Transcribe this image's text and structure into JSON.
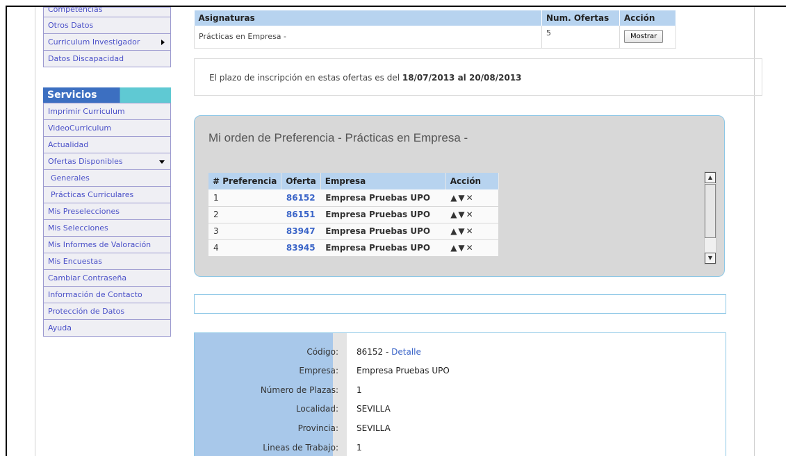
{
  "sidebar": {
    "cut_item": "Competencias",
    "items_top": [
      "Otros Datos",
      "Curriculum Investigador",
      "Datos Discapacidad"
    ],
    "services_title": "Servicios",
    "services_items": [
      "Imprimir Curriculum",
      "VideoCurriculum",
      "Actualidad",
      "Ofertas Disponibles",
      "Generales",
      "Prácticas Curriculares",
      "Mis Preselecciones",
      "Mis Selecciones",
      "Mis Informes de Valoración",
      "Mis Encuestas",
      "Cambiar Contraseña",
      "Información de Contacto",
      "Protección de Datos",
      "Ayuda"
    ]
  },
  "asignaturas": {
    "headers": [
      "Asignaturas",
      "Num. Ofertas",
      "Acción"
    ],
    "row": {
      "name": "Prácticas en Empresa -",
      "num": "5",
      "button": "Mostrar"
    }
  },
  "plazo": {
    "text": "El plazo de inscripción en estas ofertas es del ",
    "dates": "18/07/2013 al 20/08/2013"
  },
  "preferencia": {
    "title": "Mi orden de Preferencia - Prácticas en Empresa -",
    "headers": [
      "# Preferencia",
      "Oferta",
      "Empresa",
      "Acción"
    ],
    "rows": [
      {
        "pref": "1",
        "oferta": "86152",
        "empresa": "Empresa Pruebas UPO"
      },
      {
        "pref": "2",
        "oferta": "86151",
        "empresa": "Empresa Pruebas UPO"
      },
      {
        "pref": "3",
        "oferta": "83947",
        "empresa": "Empresa Pruebas UPO"
      },
      {
        "pref": "4",
        "oferta": "83945",
        "empresa": "Empresa Pruebas UPO"
      }
    ],
    "action_icons": [
      "arrow-up-icon",
      "arrow-down-icon",
      "delete-x-icon"
    ]
  },
  "detalle": {
    "codigo_label": "Código:",
    "codigo_value": "86152 - ",
    "codigo_link": "Detalle",
    "empresa_label": "Empresa:",
    "empresa_value": "Empresa Pruebas UPO",
    "plazas_label": "Número de Plazas:",
    "plazas_value": "1",
    "localidad_label": "Localidad:",
    "localidad_value": "SEVILLA",
    "provincia_label": "Provincia:",
    "provincia_value": "SEVILLA",
    "lineas_label": "Lineas de Trabajo:",
    "lineas_value": "1"
  },
  "colors": {
    "link": "#3b65c8",
    "header_bg": "#b7d3ef",
    "services_bg": "#3c6fc1",
    "panel_border": "#8cc7e6"
  }
}
